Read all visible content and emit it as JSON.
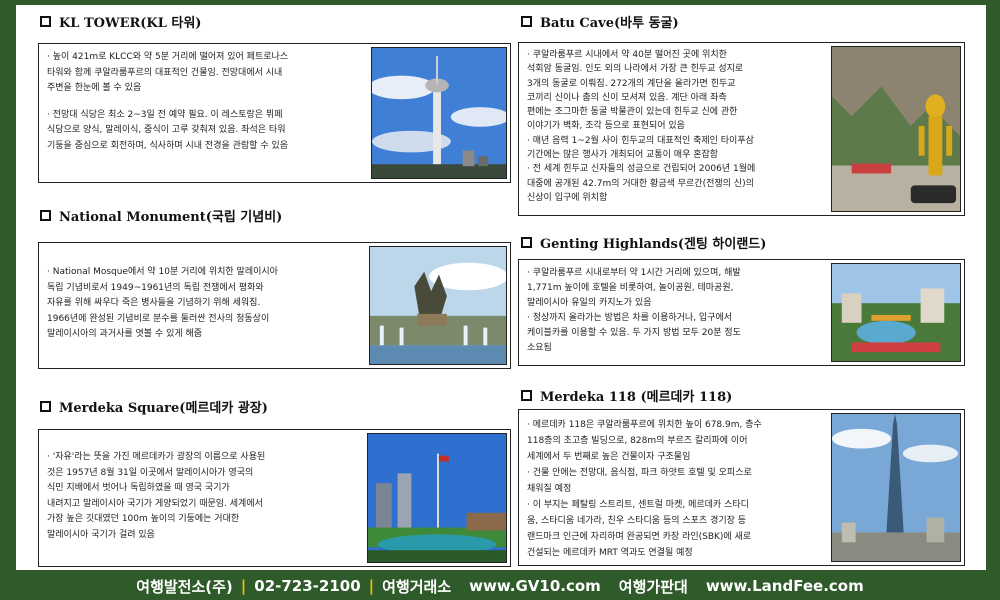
{
  "sections": {
    "kl_tower": {
      "title": "KL TOWER(KL 타워)",
      "p1_l1": "· 높이 421m로 KLCC와 약 5분 거리에 떨어져 있어 페트로나스",
      "p1_l2": "  타워와 함께 쿠알라룸푸르의 대표적인 건물임. 전망대에서 시내",
      "p1_l3": "  주변을 한눈에 볼 수 있음",
      "p2_l1": "· 전망대 식당은 최소 2~3일 전 예약 필요. 이 레스토랑은 뷔페",
      "p2_l2": "  식당으로 양식, 말레이식, 중식이 고루 갖춰져 있음. 좌석은 타워",
      "p2_l3": "  기둥을 중심으로 회전하며, 식사하며 시내 전경을 관람할 수 있음"
    },
    "national_monument": {
      "title": "National Monument(국립 기념비)",
      "l1": "· National Mosque에서 약 10분 거리에 위치한 말레이시아",
      "l2": "  독립 기념비로서 1949~1961년의 독립 전쟁에서 평화와",
      "l3": "  자유를 위해 싸우다 죽은 병사들을 기념하기 위해 세워짐.",
      "l4": "  1966년에 완성된 기념비로 분수를 둘러싼 전사의 청동상이",
      "l5": "  말레이시아의 과거사를 엿볼 수 있게 해줌"
    },
    "merdeka_square": {
      "title": "Merdeka Square(메르데카 광장)",
      "l1": "· '자유'라는 뜻을 가진 메르데카가 광장의 이름으로 사용된",
      "l2": "  것은 1957년 8월 31일 이곳에서 말레이시아가 영국의",
      "l3": "  식민 지배에서 벗어나 독립하였을 때 영국 국기가",
      "l4": "  내려지고 말레이시아 국기가 게양되었기 때문임. 세계에서",
      "l5": "  가장 높은 깃대였던 100m 높이의 기둥에는 거대한",
      "l6": "  말레이시아 국기가 걸려 있음"
    },
    "batu_cave": {
      "title": "Batu Cave(바투 동굴)",
      "l1": "· 쿠알라룸푸르 시내에서 약 40분 떨어진 곳에 위치한",
      "l2": "  석회암 동굴임. 인도 외의 나라에서 가장 큰 힌두교 성지로",
      "l3": "  3개의 동굴로 이뤄짐. 272개의 계단을 올라가면 힌두교",
      "l4": "  코끼리 신이나 춤의 신이 모셔져 있음. 계단 아래 좌측",
      "l5": "  편에는 조그마한 동굴 박물관이 있는데 힌두교 신에 관한",
      "l6": "  이야기가 벽화, 조각 등으로 표현되어 있음",
      "l7": "· 매년 음력 1~2월 사이 힌두교의 대표적인 축제인 타이푸삼",
      "l8": "  기간에는 많은 행사가 개최되어 교통이 매우 혼잡함",
      "l9": "· 전 세계 힌두교 신자들의 성금으로 건립되어 2006년 1월에",
      "l10": "  대중에 공개된 42.7m의 거대한 황금색 무르간(전쟁의 신)의",
      "l11": "  신상이 입구에 위치함"
    },
    "genting": {
      "title": "Genting Highlands(겐팅 하이랜드)",
      "l1": "· 쿠알라룸푸르 시내로부터 약 1시간 거리에 있으며, 해발",
      "l2": "  1,771m 높이에 호텔을 비롯하여, 놀이공원, 테마공원,",
      "l3": "  말레이시아 유일의 카지노가 있음",
      "l4": "· 정상까지 올라가는 방법은 차를 이용하거나, 입구에서",
      "l5": "  케이블카를 이용할 수 있음. 두 가지 방법 모두 20분 정도",
      "l6": "  소요됨"
    },
    "merdeka_118": {
      "title": "Merdeka 118 (메르데카 118)",
      "l1": "· 메르데카 118은 쿠알라룸푸르에 위치한 높이 678.9m, 층수",
      "l2": "  118층의 초고층 빌딩으로, 828m의 부르즈 칼리파에 이어",
      "l3": "  세계에서 두 번째로 높은 건물이자 구조물임",
      "l4": "· 건물 안에는 전망대, 음식점, 파크 하얏트 호텔 및 오피스로",
      "l5": "  채워질 예정",
      "l6": "· 이 부지는 페탈링 스트리트, 센트럴 마켓, 메르데카 스타디",
      "l7": "  움, 스타디움 네가라, 친우 스타디움 등의 스포츠 경기장 등",
      "l8": "  랜드마크 인근에 자리하며 완공되면 카장 라인(SBK)에 새로",
      "l9": "  건설되는 메르데카 MRT 역과도 연결될 예정"
    }
  },
  "footer": {
    "company": "여행발전소(주)",
    "phone": "02-723-2100",
    "exchange": "여행거래소",
    "site1": "www.GV10.com",
    "board": "여행가판대",
    "site2": "www.LandFee.com"
  },
  "colors": {
    "frame_green": "#2f5a2a",
    "separator_gold": "#f0c000"
  },
  "icons": [
    "checkbox-icon"
  ]
}
